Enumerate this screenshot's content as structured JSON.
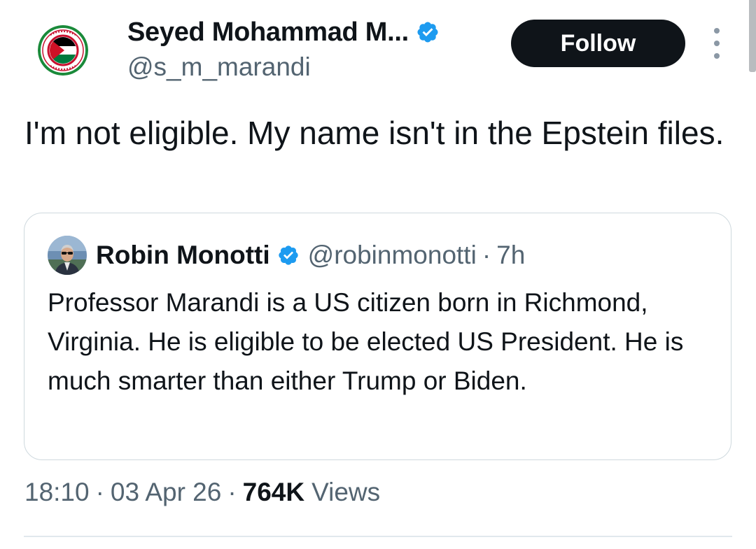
{
  "author": {
    "name": "Seyed Mohammad M...",
    "handle": "@s_m_marandi",
    "verified": true,
    "avatar_icon": "save-gaza-palestine-flag-emblem-icon"
  },
  "actions": {
    "follow_label": "Follow",
    "more_icon": "more-options-vertical-icon"
  },
  "tweet": {
    "text": "I'm not eligible. My name isn't in the Epstein files."
  },
  "quoted_tweet": {
    "name": "Robin Monotti",
    "handle": "@robinmonotti",
    "separator": "·",
    "time": "7h",
    "verified": true,
    "avatar_icon": "profile-photo-man-with-sunglasses-icon",
    "text": "Professor Marandi is a US citizen born in Richmond, Virginia. He is eligible to be elected US President. He is much smarter than either Trump or Biden."
  },
  "meta": {
    "time": "18:10",
    "separator": "·",
    "date": "03 Apr 26",
    "views_count": "764K",
    "views_label": "Views"
  },
  "colors": {
    "text_primary": "#0f1419",
    "text_secondary": "#536471",
    "verified_blue": "#1d9bf0",
    "follow_bg": "#0f1419",
    "border": "#cfd9de"
  }
}
